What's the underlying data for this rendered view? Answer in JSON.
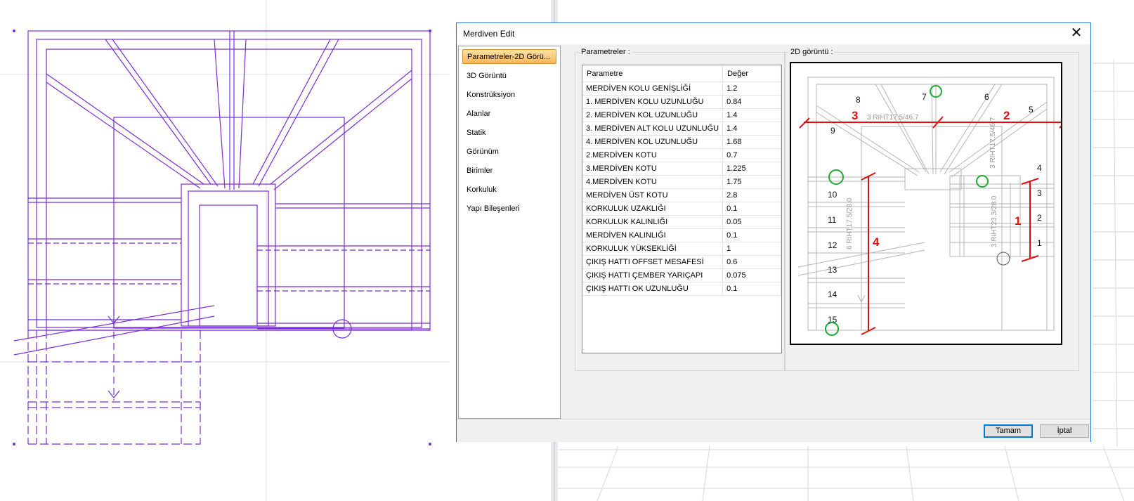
{
  "dialog": {
    "title": "Merdiven Edit",
    "close_glyph": "✕"
  },
  "sidebar": {
    "items": [
      {
        "label": "Parametreler-2D Görü..."
      },
      {
        "label": "3D Görüntü"
      },
      {
        "label": "Konstrüksiyon"
      },
      {
        "label": "Alanlar"
      },
      {
        "label": "Statik"
      },
      {
        "label": "Görünüm"
      },
      {
        "label": "Birimler"
      },
      {
        "label": "Korkuluk"
      },
      {
        "label": "Yapı Bileşenleri"
      }
    ]
  },
  "params": {
    "group_label": "Parametreler :",
    "col_param": "Parametre",
    "col_value": "Değer",
    "rows": [
      {
        "name": "MERDİVEN KOLU GENİŞLİĞİ",
        "value": "1.2"
      },
      {
        "name": "1. MERDİVEN KOLU UZUNLUĞU",
        "value": "0.84"
      },
      {
        "name": "2. MERDİVEN KOL UZUNLUĞU",
        "value": "1.4"
      },
      {
        "name": "3. MERDİVEN ALT KOLU UZUNLUĞU",
        "value": "1.4"
      },
      {
        "name": "4. MERDİVEN KOL UZUNLUĞU",
        "value": "1.68"
      },
      {
        "name": " 2.MERDİVEN KOTU",
        "value": "0.7"
      },
      {
        "name": "3.MERDİVEN KOTU",
        "value": "1.225"
      },
      {
        "name": " 4.MERDİVEN KOTU",
        "value": "1.75"
      },
      {
        "name": "MERDİVEN ÜST KOTU",
        "value": "2.8"
      },
      {
        "name": "KORKULUK UZAKLIĞI",
        "value": "0.1"
      },
      {
        "name": "KORKULUK KALINLIĞI",
        "value": "0.05"
      },
      {
        "name": "MERDİVEN KALINLIĞI",
        "value": "0.1"
      },
      {
        "name": "KORKULUK YÜKSEKLİĞİ",
        "value": "1"
      },
      {
        "name": "ÇIKIŞ HATTI OFFSET MESAFESİ",
        "value": "0.6"
      },
      {
        "name": "ÇIKIŞ HATTI ÇEMBER YARIÇAPI",
        "value": "0.075"
      },
      {
        "name": "ÇIKIŞ HATTI OK UZUNLUĞU",
        "value": "0.1"
      }
    ]
  },
  "view2d": {
    "group_label": "2D görüntü :",
    "step_numbers": [
      "1",
      "2",
      "3",
      "4",
      "5",
      "6",
      "7",
      "8",
      "9",
      "10",
      "11",
      "12",
      "13",
      "14",
      "15"
    ],
    "flight_numbers": [
      "1",
      "2",
      "3",
      "4"
    ],
    "riht_labels": [
      "3 RIHT17.5/46.7",
      "3 RIHT17.5/46.7",
      "3 RIHT23.3/28.0",
      "6 RIHT17.5/28.0"
    ],
    "colors": {
      "annotation": "#e01010",
      "marker": "#22aa33",
      "line": "#b0b0b0"
    }
  },
  "footer": {
    "ok_label": "Tamam",
    "cancel_label": "İptal"
  },
  "colors": {
    "cad_line": "#7b2cd6",
    "dialog_border": "#1e6fd9",
    "active_tab": "#f6b55a"
  }
}
